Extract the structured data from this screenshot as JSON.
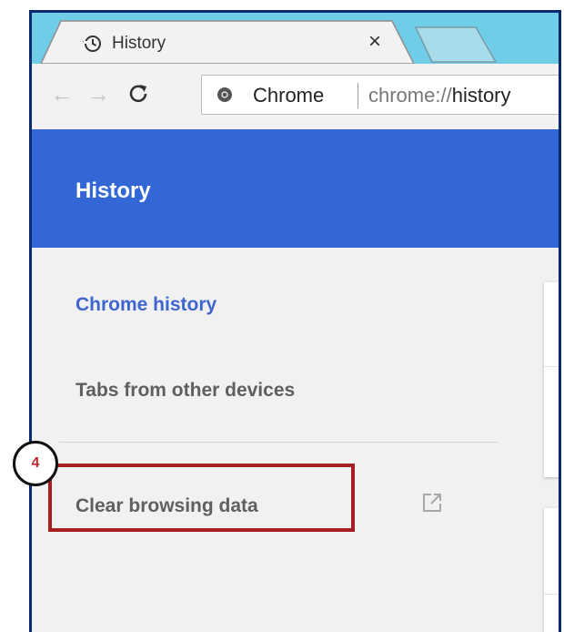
{
  "browser": {
    "tab": {
      "title": "History",
      "close_symbol": "×",
      "icon": "history-icon"
    },
    "toolbar": {
      "back_symbol": "←",
      "forward_symbol": "→",
      "reload_symbol": "C",
      "site_label": "Chrome",
      "url_prefix": "chrome://",
      "url_path": "history",
      "site_icon": "chrome-icon"
    }
  },
  "page": {
    "header_title": "History",
    "header_color": "#3367d6",
    "sidebar": {
      "items": [
        {
          "label": "Chrome history",
          "active": true
        },
        {
          "label": "Tabs from other devices",
          "active": false
        },
        {
          "label": "Clear browsing data",
          "active": false,
          "icon": "external-link-icon"
        }
      ]
    }
  },
  "annotation": {
    "step_number": "4",
    "color": "#a51e22"
  }
}
